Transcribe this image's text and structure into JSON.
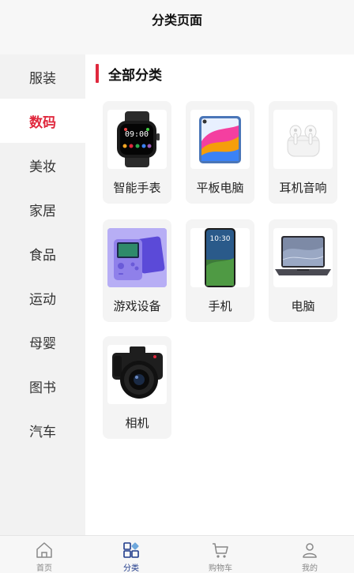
{
  "header": {
    "title": "分类页面"
  },
  "sidebar": {
    "items": [
      {
        "label": "服装",
        "active": false
      },
      {
        "label": "数码",
        "active": true
      },
      {
        "label": "美妆",
        "active": false
      },
      {
        "label": "家居",
        "active": false
      },
      {
        "label": "食品",
        "active": false
      },
      {
        "label": "运动",
        "active": false
      },
      {
        "label": "母婴",
        "active": false
      },
      {
        "label": "图书",
        "active": false
      },
      {
        "label": "汽车",
        "active": false
      }
    ]
  },
  "main": {
    "section_title": "全部分类",
    "categories": [
      {
        "label": "智能手表",
        "icon": "smartwatch-icon"
      },
      {
        "label": "平板电脑",
        "icon": "tablet-icon"
      },
      {
        "label": "耳机音响",
        "icon": "earbuds-icon"
      },
      {
        "label": "游戏设备",
        "icon": "game-console-icon"
      },
      {
        "label": "手机",
        "icon": "phone-icon"
      },
      {
        "label": "电脑",
        "icon": "laptop-icon"
      },
      {
        "label": "相机",
        "icon": "camera-icon"
      }
    ],
    "phone_time": "10:30"
  },
  "tabbar": {
    "items": [
      {
        "label": "首页",
        "icon": "home-icon",
        "active": false
      },
      {
        "label": "分类",
        "icon": "category-icon",
        "active": true
      },
      {
        "label": "购物车",
        "icon": "cart-icon",
        "active": false
      },
      {
        "label": "我的",
        "icon": "profile-icon",
        "active": false
      }
    ]
  },
  "colors": {
    "accent": "#e0283d",
    "tab_active": "#1f3a8a"
  }
}
